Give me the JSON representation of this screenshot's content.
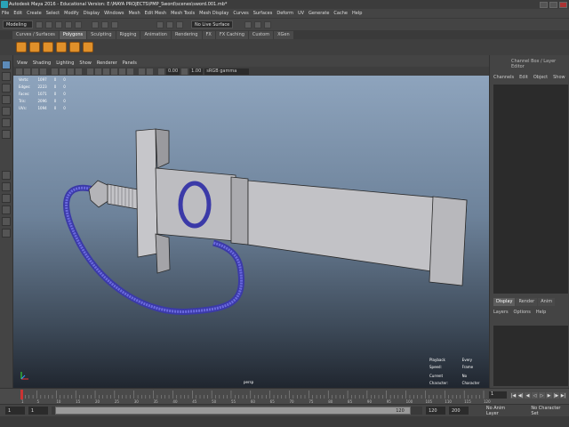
{
  "title": "Autodesk Maya 2016 - Educational Version: E:\\MAYA PROJECTS\\PMP_Sword\\scenes\\sword.001.mb*",
  "menu": [
    "File",
    "Edit",
    "Create",
    "Select",
    "Modify",
    "Display",
    "Windows",
    "Mesh",
    "Edit Mesh",
    "Mesh Tools",
    "Mesh Display",
    "Curves",
    "Surfaces",
    "Deform",
    "UV",
    "Generate",
    "Cache",
    "Help"
  ],
  "status": {
    "mode": "Modeling",
    "live_surface": "No Live Surface"
  },
  "shelf_tabs": [
    "Curves / Surfaces",
    "Polygons",
    "Sculpting",
    "Rigging",
    "Animation",
    "Rendering",
    "FX",
    "FX Caching",
    "Custom",
    "XGen"
  ],
  "viewport_menu": [
    "View",
    "Shading",
    "Lighting",
    "Show",
    "Renderer",
    "Panels"
  ],
  "viewport_toolbar": {
    "exposure": "0.00",
    "gamma": "1.00",
    "colorspace": "sRGB gamma"
  },
  "hud_poly": [
    {
      "label": "Verts:",
      "v1": "1097",
      "v2": "0",
      "v3": "0"
    },
    {
      "label": "Edges:",
      "v1": "2223",
      "v2": "0",
      "v3": "0"
    },
    {
      "label": "Faces:",
      "v1": "1071",
      "v2": "0",
      "v3": "0"
    },
    {
      "label": "Tris:",
      "v1": "2096",
      "v2": "0",
      "v3": "0"
    },
    {
      "label": "UVs:",
      "v1": "1094",
      "v2": "0",
      "v3": "0"
    }
  ],
  "hud_right": [
    {
      "label": "Playback Speed:",
      "value": "Every Frame"
    },
    {
      "label": "Current Character:",
      "value": "No Character"
    },
    {
      "label": "IK Blend:",
      "value": "No Solver"
    },
    {
      "label": "Frame:",
      "value": "1"
    }
  ],
  "camera": "persp",
  "right_panel": {
    "title": "Channel Box / Layer Editor",
    "tabs": [
      "Channels",
      "Edit",
      "Object",
      "Show"
    ],
    "layer_tabs": [
      "Display",
      "Render",
      "Anim"
    ],
    "layer_menu": [
      "Layers",
      "Options",
      "Help"
    ]
  },
  "timeline": {
    "ticks": [
      "1",
      "5",
      "10",
      "15",
      "20",
      "25",
      "30",
      "35",
      "40",
      "45",
      "50",
      "55",
      "60",
      "65",
      "70",
      "75",
      "80",
      "85",
      "90",
      "95",
      "100",
      "105",
      "110",
      "115",
      "120"
    ],
    "current_frame": "1"
  },
  "range": {
    "start": "1",
    "inner_start": "1",
    "inner_end": "120",
    "end_a": "120",
    "end_b": "200",
    "anim_layer": "No Anim Layer",
    "char_set": "No Character Set"
  },
  "colors": {
    "accent": "#5c8ab8",
    "shelf_icon": "#e0902a",
    "wire": "#4a47c8"
  }
}
